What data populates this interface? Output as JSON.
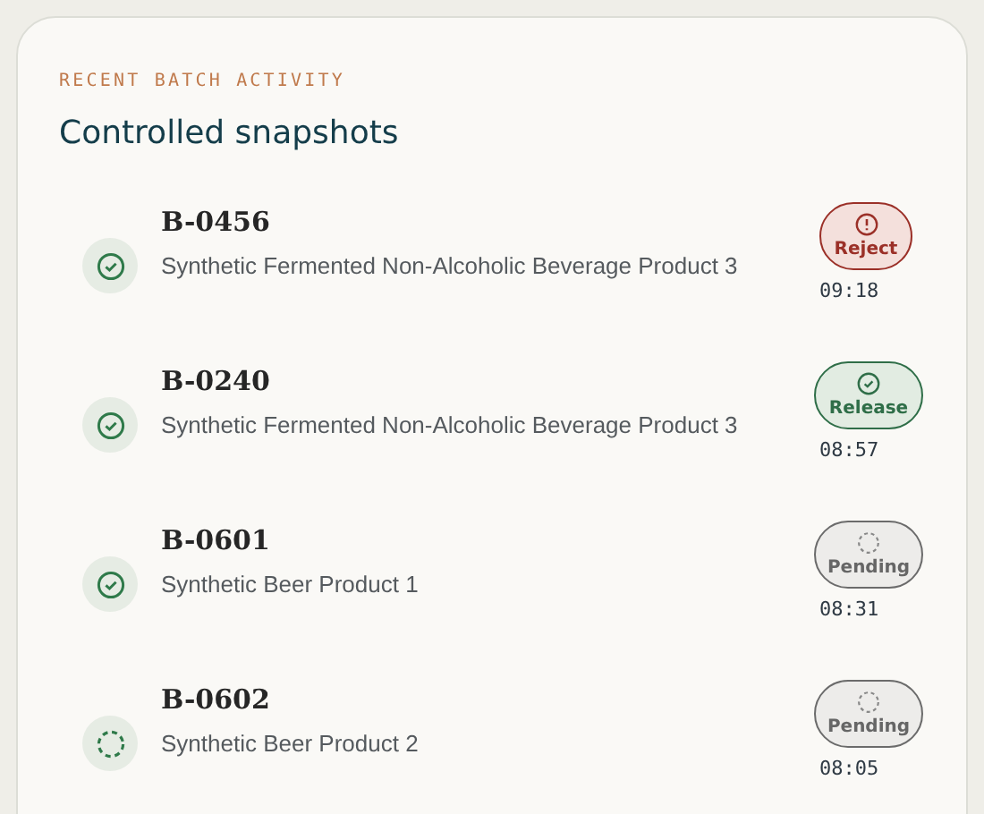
{
  "eyebrow": "RECENT BATCH ACTIVITY",
  "title": "Controlled snapshots",
  "batches": [
    {
      "kind": "complete",
      "id": "B-0456",
      "product": "Synthetic Fermented Non-Alcoholic Beverage Product 3",
      "decision": {
        "kind": "reject",
        "label": "Reject"
      },
      "time": "09:18"
    },
    {
      "kind": "complete",
      "id": "B-0240",
      "product": "Synthetic Fermented Non-Alcoholic Beverage Product 3",
      "decision": {
        "kind": "release",
        "label": "Release"
      },
      "time": "08:57"
    },
    {
      "kind": "complete",
      "id": "B-0601",
      "product": "Synthetic Beer Product 1",
      "decision": {
        "kind": "pending",
        "label": "Pending"
      },
      "time": "08:31"
    },
    {
      "kind": "in-progress",
      "id": "B-0602",
      "product": "Synthetic Beer Product 2",
      "decision": {
        "kind": "pending",
        "label": "Pending"
      },
      "time": "08:05"
    }
  ]
}
